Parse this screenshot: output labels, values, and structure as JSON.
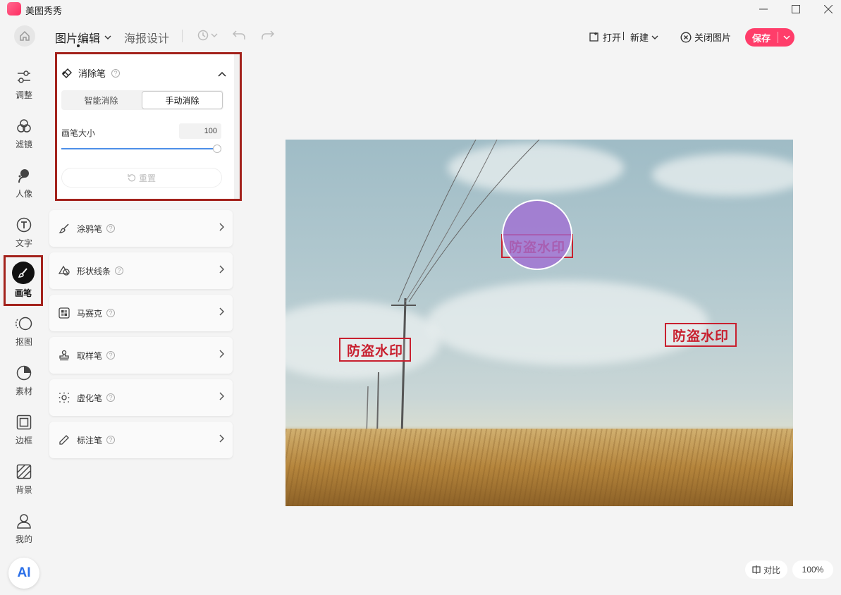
{
  "window": {
    "title": "美图秀秀",
    "controls": [
      "minimize",
      "maximize",
      "close"
    ]
  },
  "top_bar": {
    "tab_active": "图片编辑",
    "tab_second": "海报设计",
    "open_label": "打开",
    "new_label": "新建",
    "close_image_label": "关闭图片",
    "save_label": "保存"
  },
  "sidebar": {
    "items": [
      {
        "label": "调整",
        "icon": "sliders-icon"
      },
      {
        "label": "滤镜",
        "icon": "filter-circles-icon"
      },
      {
        "label": "人像",
        "icon": "portrait-icon"
      },
      {
        "label": "文字",
        "icon": "text-icon"
      },
      {
        "label": "画笔",
        "icon": "brush-icon",
        "active": true
      },
      {
        "label": "抠图",
        "icon": "cutout-icon"
      },
      {
        "label": "素材",
        "icon": "sticker-icon"
      },
      {
        "label": "边框",
        "icon": "frame-icon"
      },
      {
        "label": "背景",
        "icon": "background-icon"
      },
      {
        "label": "我的",
        "icon": "user-icon"
      }
    ],
    "ai_label": "AI"
  },
  "eraser_panel": {
    "title": "消除笔",
    "help": "?",
    "mode_smart": "智能消除",
    "mode_manual": "手动消除",
    "active_mode": "手动消除",
    "size_label": "画笔大小",
    "size_value": "100",
    "slider_fraction": 1.0,
    "reset_label": "重置"
  },
  "tools": [
    {
      "label": "涂鸦笔",
      "icon": "doodle-brush-icon"
    },
    {
      "label": "形状线条",
      "icon": "shapes-icon"
    },
    {
      "label": "马赛克",
      "icon": "mosaic-icon"
    },
    {
      "label": "取样笔",
      "icon": "stamp-icon"
    },
    {
      "label": "虚化笔",
      "icon": "blur-icon"
    },
    {
      "label": "标注笔",
      "icon": "pen-icon"
    }
  ],
  "canvas": {
    "watermark_text": "防盗水印"
  },
  "bottom": {
    "compare_label": "对比",
    "zoom_label": "100%"
  },
  "colors": {
    "accent": "#ff3d6a",
    "highlight_border": "#a3221c",
    "watermark": "#c8202f",
    "slider": "#4d8fe8"
  }
}
